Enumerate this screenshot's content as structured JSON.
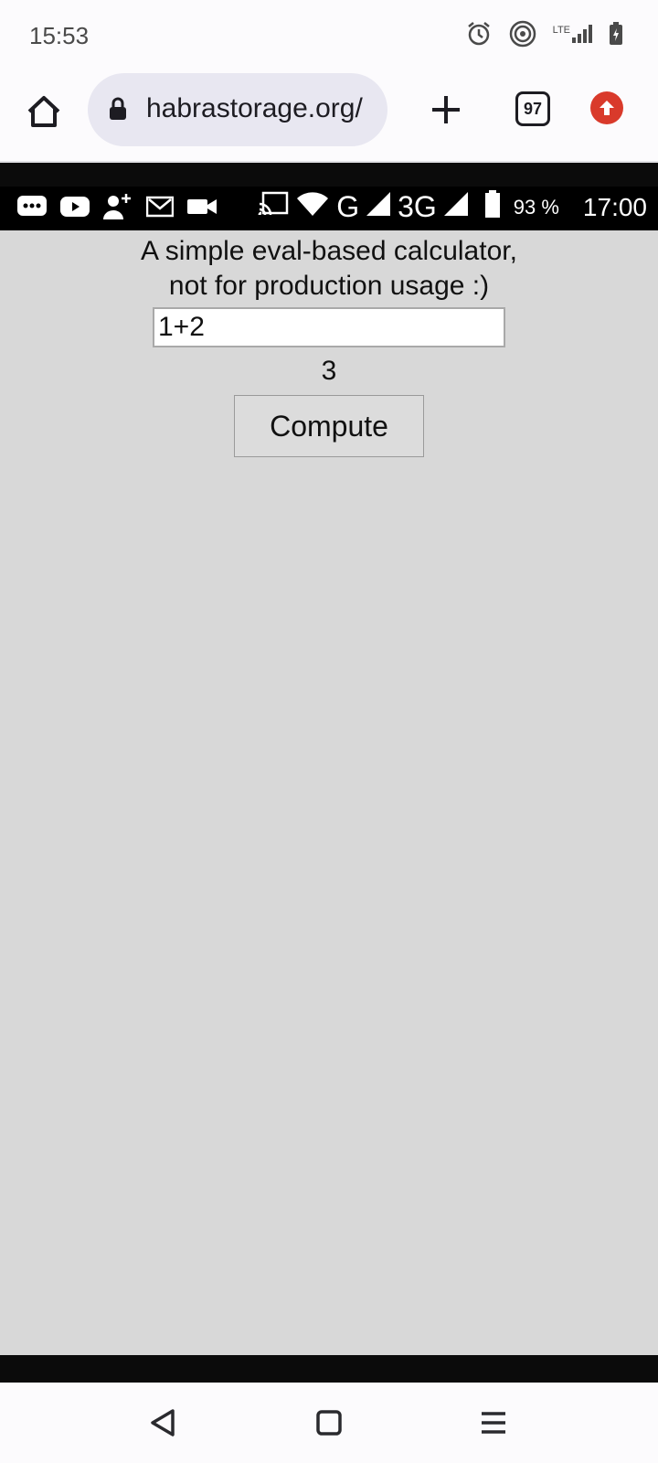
{
  "system_status": {
    "time": "15:53",
    "network_label": "LTE"
  },
  "browser": {
    "url": "habrastorage.org/",
    "tab_count": "97"
  },
  "device_status": {
    "network_g": "G",
    "network_3g": "3G",
    "battery": "93 %",
    "time": "17:00"
  },
  "page": {
    "heading_line1": "A simple eval-based calculator,",
    "heading_line2": "not for production usage :)",
    "expression": "1+2",
    "result": "3",
    "compute_label": "Compute"
  },
  "colors": {
    "accent_red": "#d93a2b",
    "page_bg": "#d8d8d8",
    "omnibox_bg": "#e8e7f1"
  }
}
